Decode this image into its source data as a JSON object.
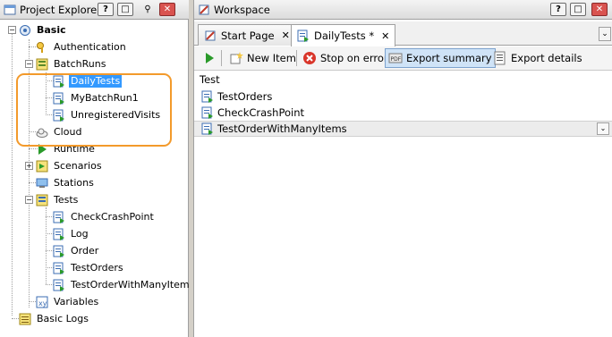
{
  "left_panel": {
    "title": "Project Explorer",
    "btn_help": "?",
    "btn_max": "□",
    "btn_pin": "⚲",
    "btn_close": "✕",
    "tree": [
      {
        "label": "Basic",
        "icon": "project-suite-icon",
        "bold": true
      },
      {
        "label": "Authentication",
        "icon": "key-icon"
      },
      {
        "label": "BatchRuns",
        "icon": "batch-runs-icon"
      },
      {
        "label": "DailyTests",
        "icon": "test-file-icon",
        "selected": true
      },
      {
        "label": "MyBatchRun1",
        "icon": "test-file-icon"
      },
      {
        "label": "UnregisteredVisits",
        "icon": "test-file-icon"
      },
      {
        "label": "Cloud",
        "icon": "cloud-icon"
      },
      {
        "label": "Runtime",
        "icon": "play-icon"
      },
      {
        "label": "Scenarios",
        "icon": "scenarios-icon"
      },
      {
        "label": "Stations",
        "icon": "stations-icon"
      },
      {
        "label": "Tests",
        "icon": "tests-folder-icon"
      },
      {
        "label": "CheckCrashPoint",
        "icon": "test-file-icon"
      },
      {
        "label": "Log",
        "icon": "test-file-icon"
      },
      {
        "label": "Order",
        "icon": "test-file-icon"
      },
      {
        "label": "TestOrders",
        "icon": "test-file-icon"
      },
      {
        "label": "TestOrderWithManyItems",
        "icon": "test-file-icon"
      },
      {
        "label": "Variables",
        "icon": "variables-icon"
      },
      {
        "label": "Basic Logs",
        "icon": "logs-icon"
      }
    ]
  },
  "right_panel": {
    "title": "Workspace",
    "btn_help": "?",
    "btn_max": "□",
    "btn_close": "✕",
    "tabs": [
      {
        "label": "Start Page",
        "close": "✕"
      },
      {
        "label": "DailyTests *",
        "close": "✕"
      }
    ],
    "tabs_menu": "⌄",
    "toolbar": {
      "new_item": "New Item",
      "stop_on_error": "Stop on error",
      "export_summary": "Export summary",
      "export_details": "Export details"
    },
    "grid": {
      "header": "Test",
      "rows": [
        "TestOrders",
        "CheckCrashPoint",
        "TestOrderWithManyItems"
      ],
      "dropdown": "⌄"
    }
  }
}
